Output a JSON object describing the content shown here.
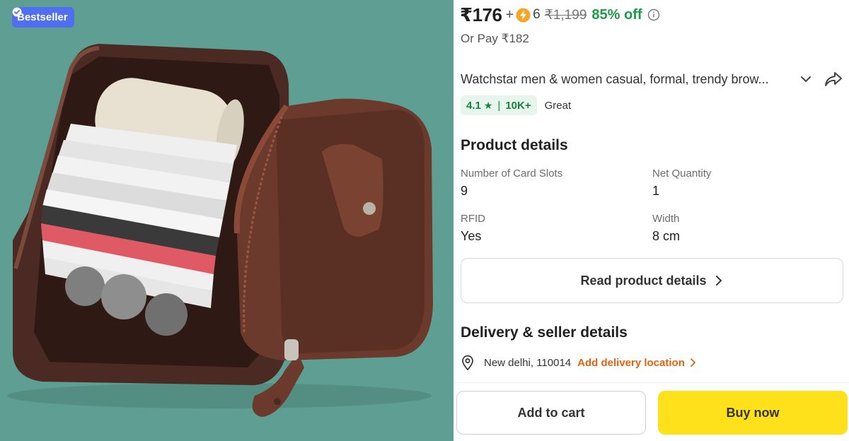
{
  "image": {
    "badge_label": "Bestseller",
    "badge_icon": "verified-check-icon"
  },
  "price": {
    "current": "₹176",
    "plus": "+",
    "coins": "6",
    "mrp": "₹1,199",
    "discount": "85% off",
    "or_pay": "Or Pay ₹182"
  },
  "product": {
    "title": "Watchstar men & women casual, formal, trendy brow...",
    "rating": "4.1",
    "rating_count": "10K+",
    "rating_word": "Great"
  },
  "details": {
    "heading": "Product details",
    "specs": [
      {
        "label": "Number of Card Slots",
        "value": "9"
      },
      {
        "label": "Net Quantity",
        "value": "1"
      },
      {
        "label": "RFID",
        "value": "Yes"
      },
      {
        "label": "Width",
        "value": "8 cm"
      }
    ],
    "read_more": "Read product details"
  },
  "delivery": {
    "heading": "Delivery & seller details",
    "location": "New delhi, 110014",
    "add_location": "Add delivery location"
  },
  "actions": {
    "add_to_cart": "Add to cart",
    "buy_now": "Buy now"
  },
  "colors": {
    "badge": "#4f6ff0",
    "discount_green": "#1b9a47",
    "rating_bg": "#e6f6ec",
    "location_orange": "#e0640f",
    "buy_yellow": "#ffe11b",
    "photo_background": "#5f9e92"
  }
}
